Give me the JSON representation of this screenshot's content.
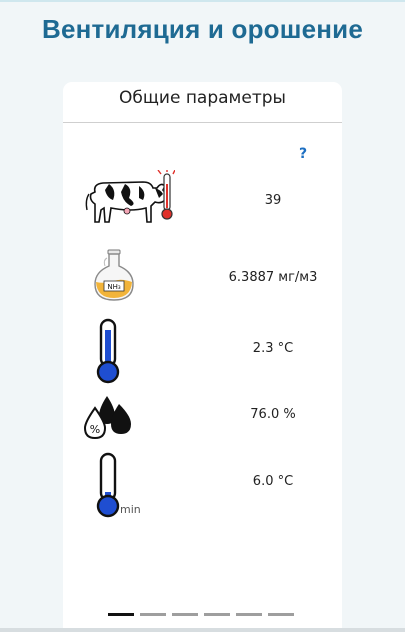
{
  "header": {
    "title": "Вентиляция и орошение"
  },
  "card": {
    "title": "Общие параметры",
    "help_label": "?",
    "rows": [
      {
        "icon": "cow-thermometer-icon",
        "value": "39"
      },
      {
        "icon": "ammonia-flask-icon",
        "value": "6.3887 мг/м3",
        "icon_label": "NH3"
      },
      {
        "icon": "thermometer-icon",
        "value": "2.3 °C"
      },
      {
        "icon": "humidity-drops-icon",
        "value": "76.0 %",
        "icon_label": "%"
      },
      {
        "icon": "thermometer-min-icon",
        "value": "6.0 °C",
        "icon_label": "min"
      }
    ]
  },
  "pagination": {
    "pages": 6,
    "active": 0
  },
  "colors": {
    "title": "#1e6a93",
    "help": "#1d6fc2",
    "thermo_blue": "#1f4ed1",
    "flask_orange": "#f2b43a"
  }
}
